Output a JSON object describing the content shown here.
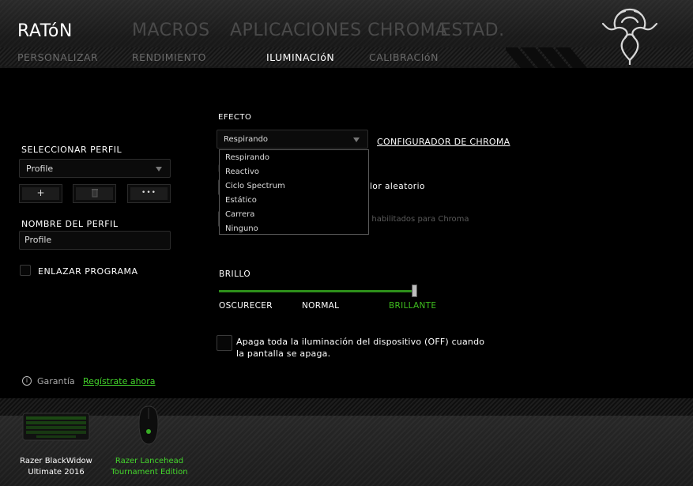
{
  "header": {
    "title": "RATóN",
    "main_nav": [
      "MACROS",
      "APLICACIONES CHROMA",
      "ESTAD."
    ],
    "sub_nav": [
      "PERSONALIZAR",
      "RENDIMIENTO",
      "ILUMINACIóN",
      "CALIBRACIóN"
    ],
    "active_sub_nav": "ILUMINACIóN"
  },
  "profile": {
    "select_label": "SELECCIONAR PERFIL",
    "selected": "Profile",
    "add_label": "+",
    "more_label": "•••",
    "name_label": "NOMBRE DEL PERFIL",
    "name_value": "Profile",
    "link_program_label": "ENLAZAR PROGRAMA"
  },
  "effect": {
    "label": "EFECTO",
    "selected": "Respirando",
    "options": [
      "Respirando",
      "Reactivo",
      "Ciclo Spectrum",
      "Estático",
      "Carrera",
      "Ninguno"
    ],
    "configurator_link": "CONFIGURADOR DE CHROMA",
    "partial_random": "lor aleatorio",
    "partial_chroma": "s habilitados para Chroma"
  },
  "brightness": {
    "label": "BRILLO",
    "level": 1.0,
    "marks": [
      "OSCURECER",
      "NORMAL",
      "BRILLANTE"
    ]
  },
  "off_option": {
    "text": "Apaga toda la iluminación del dispositivo (OFF) cuando la pantalla se apaga."
  },
  "footer": {
    "warranty_label": "Garantía",
    "register_link": "Regístrate ahora"
  },
  "devices": [
    {
      "name_line1": "Razer BlackWidow",
      "name_line2": "Ultimate 2016",
      "color": "#ffffff"
    },
    {
      "name_line1": "Razer Lancehead",
      "name_line2": "Tournament Edition",
      "color": "#44d62c"
    }
  ],
  "colors": {
    "accent": "#44d62c",
    "slider_track": "#2d8f1a",
    "background": "#000000"
  }
}
